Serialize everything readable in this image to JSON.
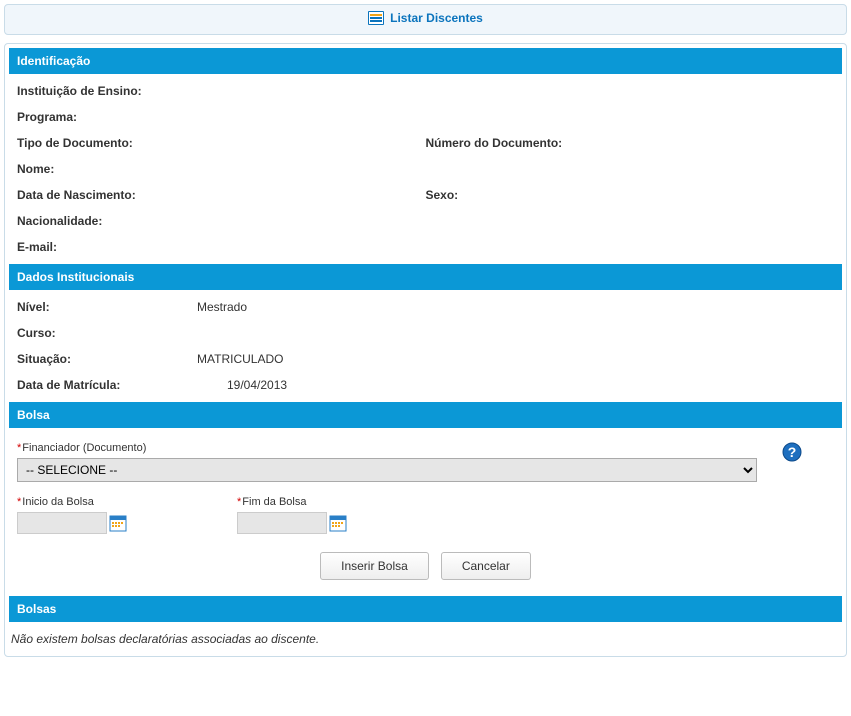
{
  "topbar": {
    "label": "Listar Discentes"
  },
  "sections": {
    "identificacao": {
      "title": "Identificação",
      "fields": {
        "instituicao_label": "Instituição de Ensino:",
        "instituicao_value": "",
        "programa_label": "Programa:",
        "programa_value": "",
        "tipo_doc_label": "Tipo de Documento:",
        "tipo_doc_value": "",
        "numero_doc_label": "Número do Documento:",
        "numero_doc_value": "",
        "nome_label": "Nome:",
        "nome_value": "",
        "data_nasc_label": "Data de Nascimento:",
        "data_nasc_value": "",
        "sexo_label": "Sexo:",
        "sexo_value": "",
        "nacionalidade_label": "Nacionalidade:",
        "nacionalidade_value": "",
        "email_label": "E-mail:",
        "email_value": ""
      }
    },
    "dados_institucionais": {
      "title": "Dados Institucionais",
      "fields": {
        "nivel_label": "Nível:",
        "nivel_value": "Mestrado",
        "curso_label": "Curso:",
        "curso_value": "",
        "situacao_label": "Situação:",
        "situacao_value": "MATRICULADO",
        "data_matricula_label": "Data de Matrícula:",
        "data_matricula_value": "19/04/2013"
      }
    },
    "bolsa": {
      "title": "Bolsa",
      "financiador_label": "Financiador (Documento)",
      "financiador_selected": "-- SELECIONE --",
      "inicio_label": "Inicio da Bolsa",
      "inicio_value": "",
      "fim_label": "Fim da Bolsa",
      "fim_value": "",
      "inserir_btn": "Inserir Bolsa",
      "cancelar_btn": "Cancelar"
    },
    "bolsas": {
      "title": "Bolsas",
      "empty_msg": "Não existem bolsas declaratórias associadas ao discente."
    }
  },
  "colors": {
    "header_bg": "#0b98d6",
    "link_blue": "#0b74bd",
    "border": "#c9dce8"
  }
}
